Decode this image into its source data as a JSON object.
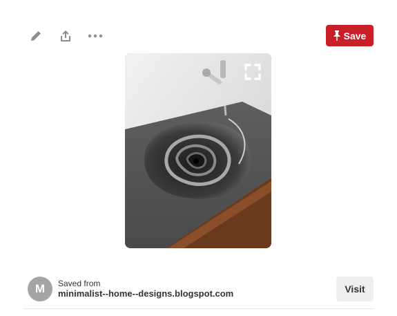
{
  "toolbar": {
    "icons": [
      "edit-icon",
      "share-icon",
      "more-icon"
    ],
    "save_label": "Save"
  },
  "pin": {
    "image_subject": "spiral nautilus-shell sink with wall faucet",
    "expand_icon": "expand-icon"
  },
  "source": {
    "avatar_letter": "M",
    "saved_from_label": "Saved from",
    "domain": "minimalist--home--designs.blogspot.com",
    "visit_label": "Visit"
  },
  "colors": {
    "save_button": "#cb1f27",
    "icon_gray": "#8e8e8e",
    "avatar": "#a5a5a5",
    "visit_button": "#efefef"
  }
}
